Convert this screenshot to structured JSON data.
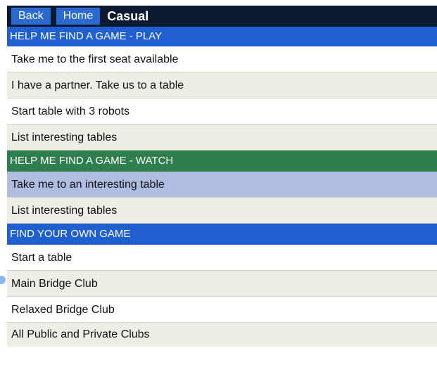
{
  "topbar": {
    "back_label": "Back",
    "home_label": "Home",
    "title": "Casual"
  },
  "sections": {
    "play": {
      "header": "HELP ME FIND A GAME - PLAY",
      "items": [
        "Take me to the first seat available",
        "I have a partner. Take us to a table",
        "Start table with 3 robots",
        "List interesting tables"
      ]
    },
    "watch": {
      "header": "HELP ME FIND A GAME - WATCH",
      "items": [
        "Take me to an interesting table",
        "List interesting tables"
      ]
    },
    "own": {
      "header": "FIND YOUR OWN GAME",
      "items": [
        "Start a table",
        "Main Bridge Club",
        "Relaxed Bridge Club",
        "All Public and Private Clubs"
      ]
    }
  },
  "colors": {
    "topbar_bg": "#0b1a31",
    "button_bg": "#2a6ad1",
    "play_header": "#1f5fd0",
    "watch_header": "#2f7f4e",
    "own_header": "#1f5fd0",
    "row_alt": "#eeede6",
    "row_selected": "#aebde0"
  }
}
